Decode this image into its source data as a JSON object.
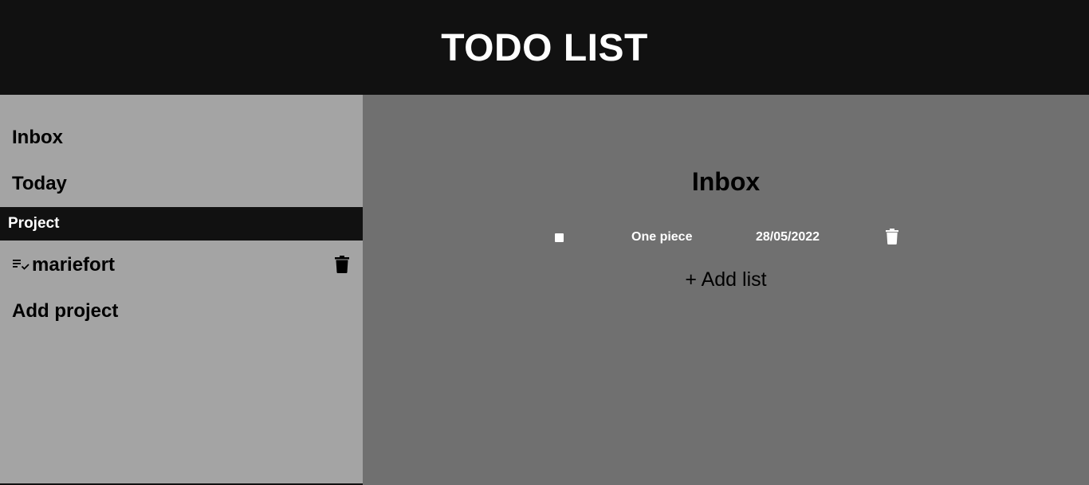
{
  "app": {
    "title": "TODO LIST"
  },
  "sidebar": {
    "items": [
      {
        "label": "Inbox"
      },
      {
        "label": "Today"
      }
    ],
    "project_section_label": "Project",
    "projects": [
      {
        "name": "mariefort",
        "icon": "playlist-check-icon",
        "delete_icon": "trash-icon"
      }
    ],
    "add_project_label": "Add project"
  },
  "main": {
    "title": "Inbox",
    "todos": [
      {
        "name": "One piece",
        "date": "28/05/2022",
        "checked": false,
        "delete_icon": "trash-icon"
      }
    ],
    "add_list_label": "+ Add list"
  },
  "colors": {
    "header_bg": "#111111",
    "sidebar_bg": "#a4a4a4",
    "main_bg": "#707070",
    "text_dark": "#000000",
    "text_light": "#ffffff"
  }
}
